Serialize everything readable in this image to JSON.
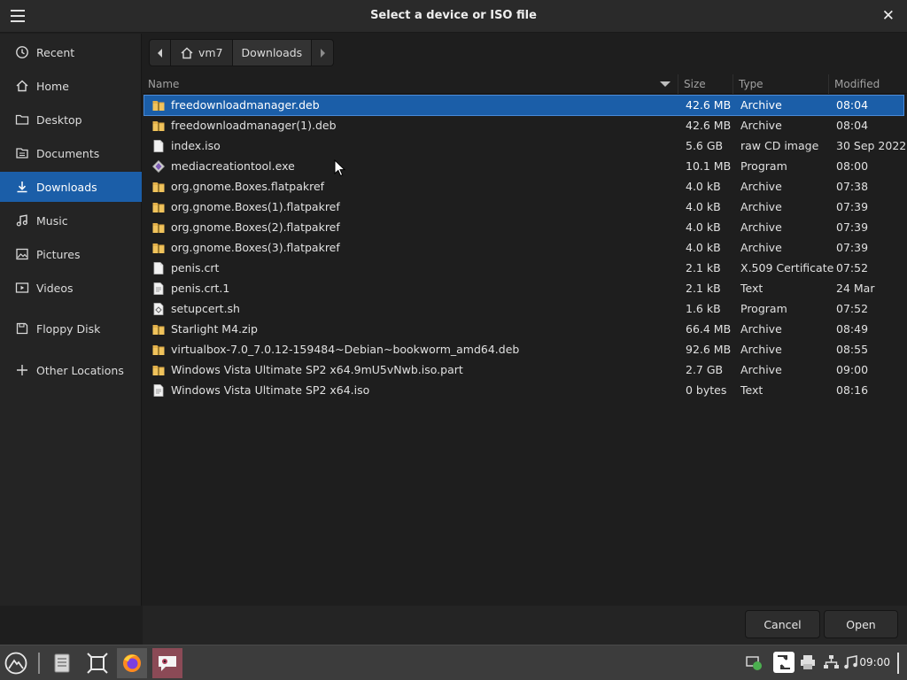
{
  "window": {
    "title": "Select a device or ISO file"
  },
  "sidebar": {
    "items": [
      {
        "label": "Recent",
        "icon": "clock-icon"
      },
      {
        "label": "Home",
        "icon": "home-icon"
      },
      {
        "label": "Desktop",
        "icon": "folder-icon"
      },
      {
        "label": "Documents",
        "icon": "document-icon"
      },
      {
        "label": "Downloads",
        "icon": "download-icon",
        "active": true
      },
      {
        "label": "Music",
        "icon": "music-icon"
      },
      {
        "label": "Pictures",
        "icon": "picture-icon"
      },
      {
        "label": "Videos",
        "icon": "video-icon"
      },
      {
        "label": "Floppy Disk",
        "icon": "floppy-icon"
      },
      {
        "label": "Other Locations",
        "icon": "plus-icon"
      }
    ]
  },
  "pathbar": {
    "segments": [
      "vm7",
      "Downloads"
    ]
  },
  "columns": {
    "name": "Name",
    "size": "Size",
    "type": "Type",
    "modified": "Modified"
  },
  "files": [
    {
      "name": "freedownloadmanager.deb",
      "size": "42.6 MB",
      "type": "Archive",
      "modified": "08:04",
      "icon": "archive",
      "selected": true
    },
    {
      "name": "freedownloadmanager(1).deb",
      "size": "42.6 MB",
      "type": "Archive",
      "modified": "08:04",
      "icon": "archive"
    },
    {
      "name": "index.iso",
      "size": "5.6 GB",
      "type": "raw CD image",
      "modified": "30 Sep 2022",
      "icon": "file"
    },
    {
      "name": "mediacreationtool.exe",
      "size": "10.1 MB",
      "type": "Program",
      "modified": "08:00",
      "icon": "exe"
    },
    {
      "name": "org.gnome.Boxes.flatpakref",
      "size": "4.0 kB",
      "type": "Archive",
      "modified": "07:38",
      "icon": "archive"
    },
    {
      "name": "org.gnome.Boxes(1).flatpakref",
      "size": "4.0 kB",
      "type": "Archive",
      "modified": "07:39",
      "icon": "archive"
    },
    {
      "name": "org.gnome.Boxes(2).flatpakref",
      "size": "4.0 kB",
      "type": "Archive",
      "modified": "07:39",
      "icon": "archive"
    },
    {
      "name": "org.gnome.Boxes(3).flatpakref",
      "size": "4.0 kB",
      "type": "Archive",
      "modified": "07:39",
      "icon": "archive"
    },
    {
      "name": "penis.crt",
      "size": "2.1 kB",
      "type": "X.509 Certificate",
      "modified": "07:52",
      "icon": "file"
    },
    {
      "name": "penis.crt.1",
      "size": "2.1 kB",
      "type": "Text",
      "modified": "24 Mar",
      "icon": "text"
    },
    {
      "name": "setupcert.sh",
      "size": "1.6 kB",
      "type": "Program",
      "modified": "07:52",
      "icon": "script"
    },
    {
      "name": "Starlight M4.zip",
      "size": "66.4 MB",
      "type": "Archive",
      "modified": "08:49",
      "icon": "archive"
    },
    {
      "name": "virtualbox-7.0_7.0.12-159484~Debian~bookworm_amd64.deb",
      "size": "92.6 MB",
      "type": "Archive",
      "modified": "08:55",
      "icon": "archive"
    },
    {
      "name": "Windows Vista Ultimate SP2 x64.9mU5vNwb.iso.part",
      "size": "2.7 GB",
      "type": "Archive",
      "modified": "09:00",
      "icon": "archive"
    },
    {
      "name": "Windows Vista Ultimate SP2 x64.iso",
      "size": "0 bytes",
      "type": "Text",
      "modified": "08:16",
      "icon": "text"
    }
  ],
  "buttons": {
    "cancel": "Cancel",
    "open": "Open"
  },
  "taskbar": {
    "clock": "09:00"
  },
  "colors": {
    "accent": "#1b5ea8",
    "background": "#1e1e1e",
    "taskbar": "#3c3c3c"
  }
}
